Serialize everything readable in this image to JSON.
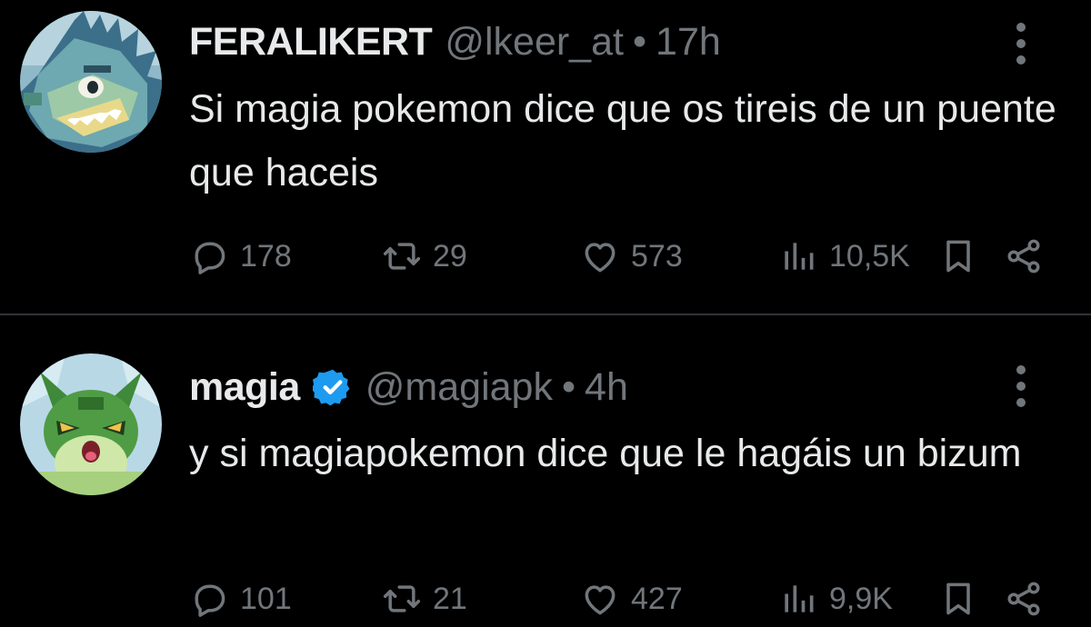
{
  "colors": {
    "background": "#000000",
    "text": "#e7e9ea",
    "muted": "#71767b",
    "divider": "#2f3336",
    "verified": "#1d9bf0"
  },
  "tweets": [
    {
      "display_name": "FERALIKERT",
      "handle": "@lkeer_at",
      "separator": "•",
      "time": "17h",
      "verified": false,
      "avatar_icon": "crocodile-pixel-avatar",
      "text": "Si magia pokemon dice que os tireis de un puente que haceis",
      "replies": "178",
      "retweets": "29",
      "likes": "573",
      "views": "10,5K"
    },
    {
      "display_name": "magia",
      "handle": "@magiapk",
      "separator": "•",
      "time": "4h",
      "verified": true,
      "avatar_icon": "green-cat-pixel-avatar",
      "text": "y si magiapokemon dice que le hagáis un bizum",
      "replies": "101",
      "retweets": "21",
      "likes": "427",
      "views": "9,9K"
    }
  ]
}
